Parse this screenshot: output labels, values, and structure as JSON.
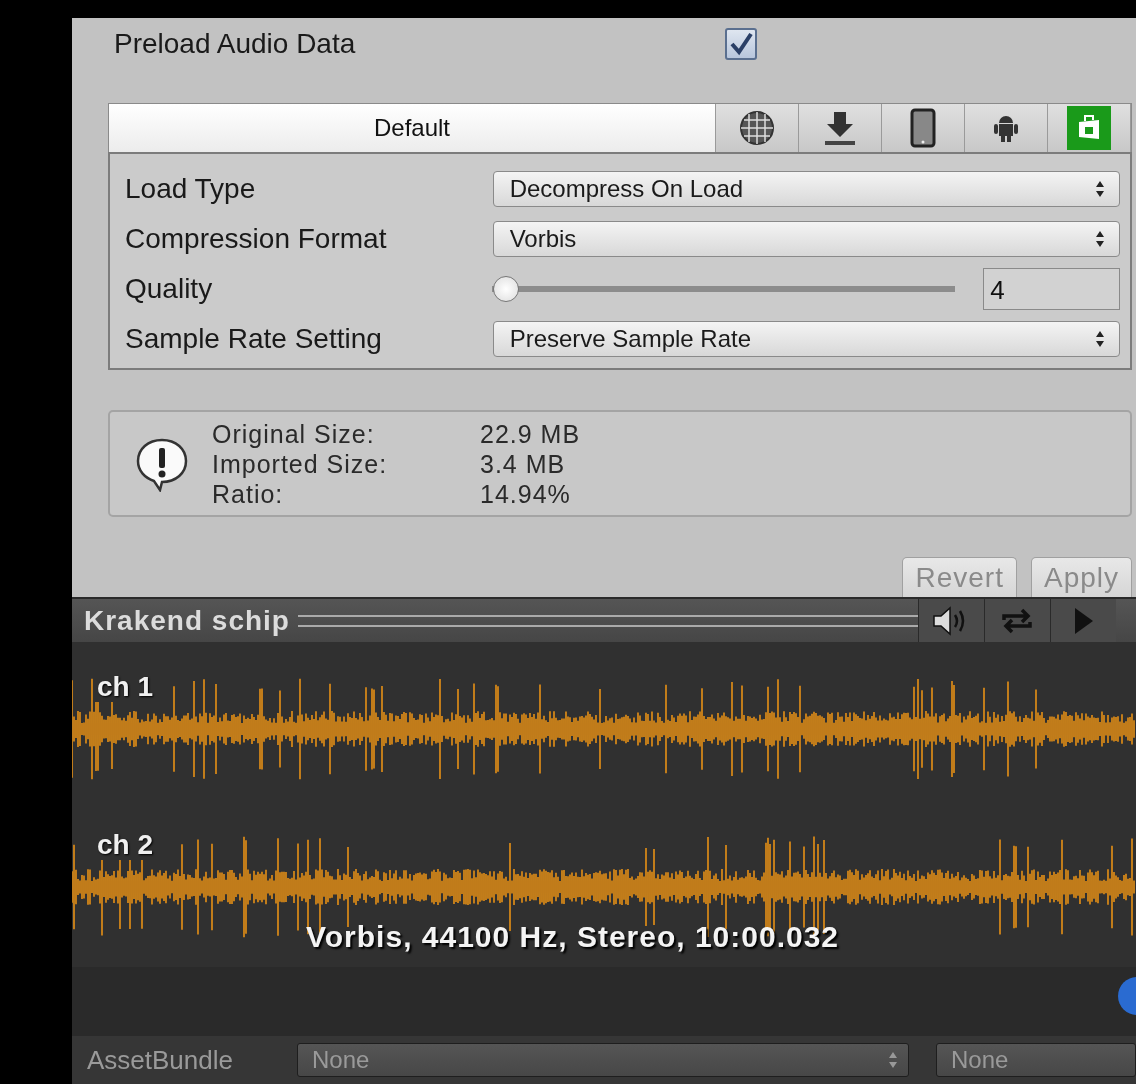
{
  "preload": {
    "label": "Preload Audio Data",
    "checked": true
  },
  "platform_tabs": [
    {
      "kind": "default",
      "label": "Default",
      "selected": true
    },
    {
      "kind": "globe",
      "selected": false
    },
    {
      "kind": "download",
      "selected": false
    },
    {
      "kind": "phone",
      "selected": false
    },
    {
      "kind": "android",
      "selected": false
    },
    {
      "kind": "store",
      "selected": false
    }
  ],
  "settings": [
    {
      "kind": "dropdown",
      "label": "Load Type",
      "value": "Decompress On Load"
    },
    {
      "kind": "dropdown",
      "label": "Compression Format",
      "value": "Vorbis"
    },
    {
      "kind": "slider",
      "label": "Quality",
      "level": 0.03,
      "value": "4"
    },
    {
      "kind": "dropdown",
      "label": "Sample Rate Setting",
      "value": "Preserve Sample Rate"
    }
  ],
  "info": [
    {
      "label": "Original Size:",
      "value": "22.9 MB"
    },
    {
      "label": "Imported Size:",
      "value": "3.4 MB"
    },
    {
      "label": "Ratio:",
      "value": "14.94%"
    }
  ],
  "buttons": [
    {
      "label": "Revert",
      "disabled": true
    },
    {
      "label": "Apply",
      "disabled": true
    }
  ],
  "preview": {
    "title": "Krakend schip",
    "channels": [
      {
        "label": "ch 1"
      },
      {
        "label": "ch 2"
      }
    ],
    "caption": "Vorbis, 44100 Hz, Stereo, 10:00.032"
  },
  "asset_bundle": {
    "label": "AssetBundle",
    "name": "None",
    "variant": "None"
  }
}
